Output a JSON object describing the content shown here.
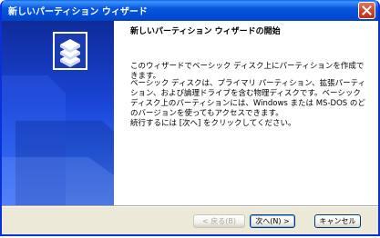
{
  "window": {
    "title": "新しいパーティション ウィザード"
  },
  "content": {
    "heading": "新しいパーティション ウィザードの開始",
    "paragraph1": "このウィザードでベーシック ディスク上にパーティションを作成できます。",
    "paragraph2": "ベーシック ディスクは、プライマリ パーティション、拡張パーティション、および論理ドライブを含む物理ディスクです。ベーシック ディスク上のパーティションには、Windows または MS-DOS のどのバージョンを使ってもアクセスできます。",
    "paragraph3": "続行するには [次へ] をクリックしてください。"
  },
  "buttons": {
    "back": "< 戻る(B)",
    "next": "次へ(N) >",
    "cancel": "キャンセル"
  },
  "icons": {
    "close": "close-icon",
    "disk": "disk-stack-icon"
  },
  "colors": {
    "titlebar": "#0054e3",
    "banner": "#1a45d6",
    "close_button": "#c9462c"
  }
}
